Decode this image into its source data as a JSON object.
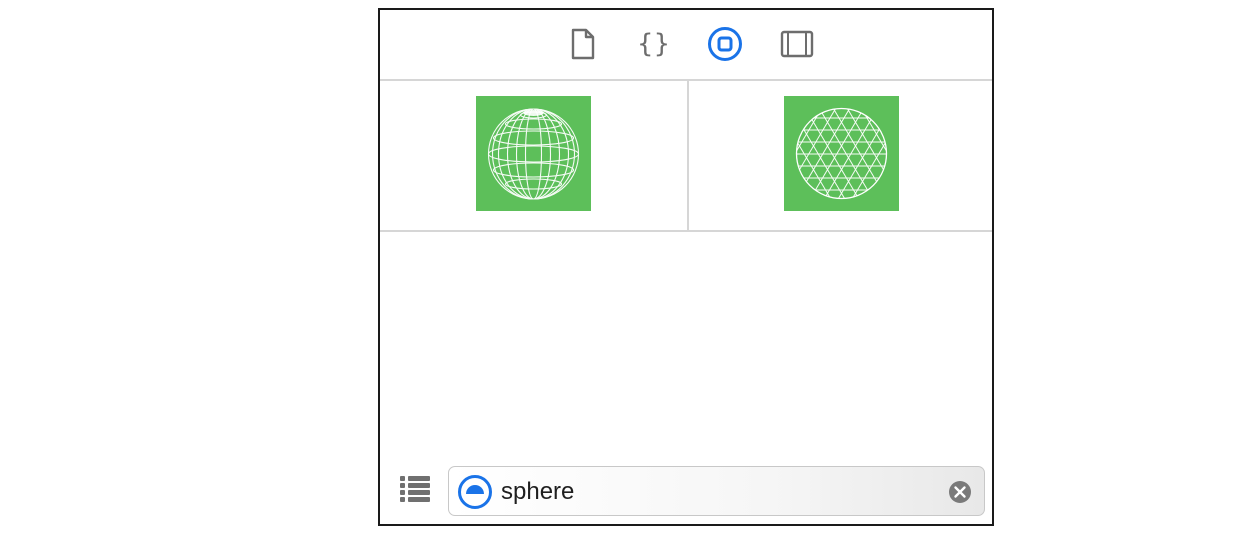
{
  "toolbar": {
    "tabs": [
      {
        "icon": "file-icon",
        "selected": false
      },
      {
        "icon": "braces-icon",
        "label": "{}",
        "selected": false
      },
      {
        "icon": "object-library-icon",
        "selected": true
      },
      {
        "icon": "media-library-icon",
        "selected": false
      }
    ]
  },
  "library": {
    "items": [
      {
        "icon": "uv-sphere-icon"
      },
      {
        "icon": "geodesic-sphere-icon"
      }
    ]
  },
  "search": {
    "value": "sphere",
    "scope_icon": "object-scope-icon",
    "clear_icon": "clear-icon"
  },
  "colors": {
    "accent": "#1a73e8",
    "thumb_bg": "#5dbf5a",
    "icon_gray": "#6d6d6d"
  }
}
